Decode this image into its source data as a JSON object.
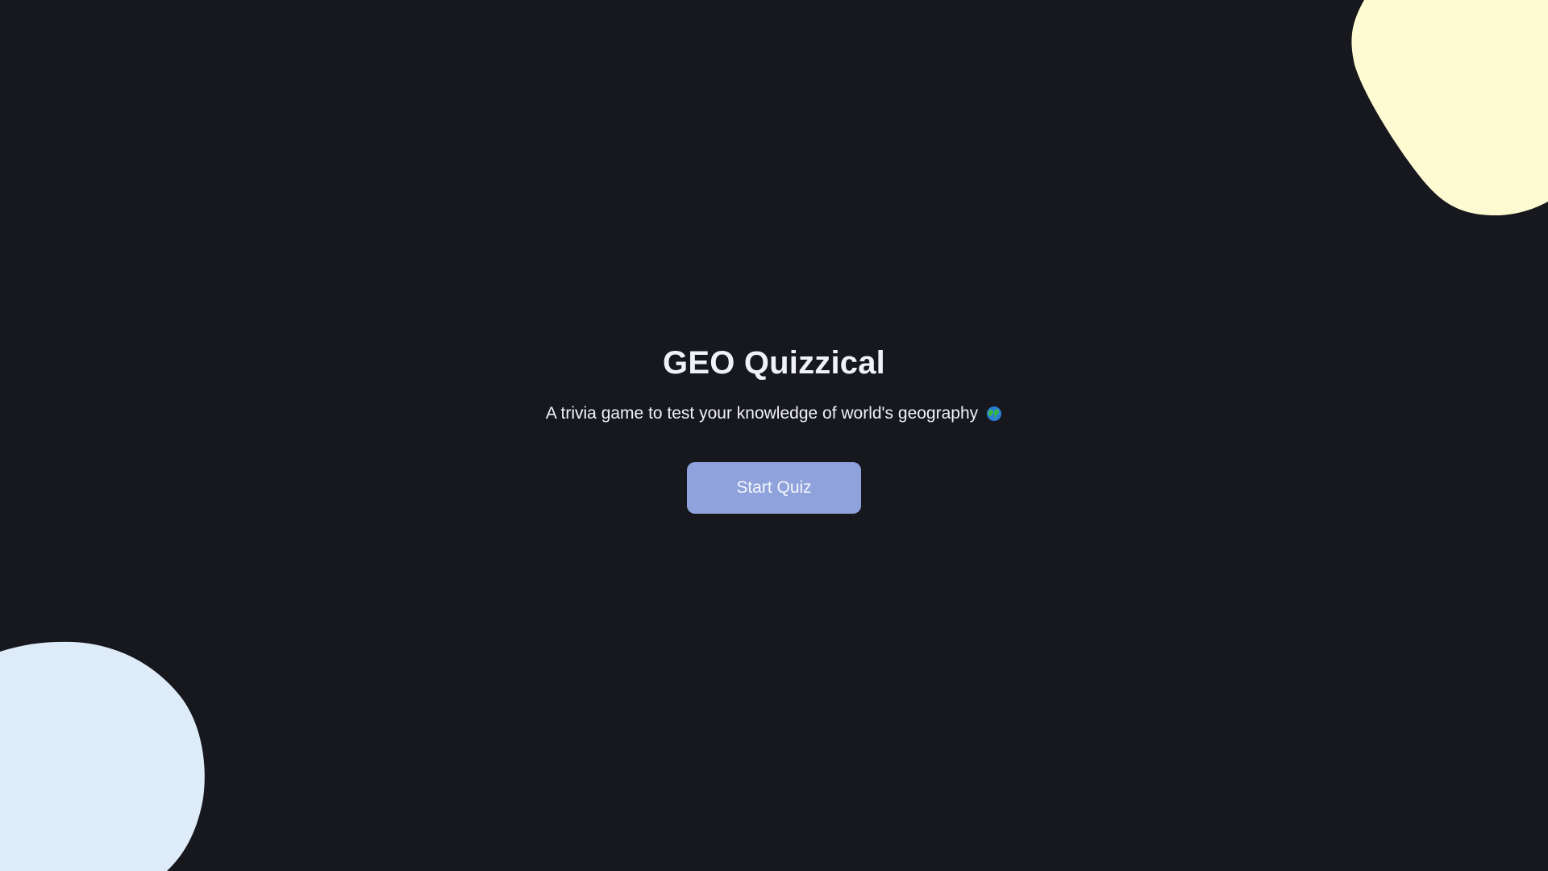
{
  "app": {
    "title": "GEO Quizzical",
    "subtitle": "A trivia game to test your knowledge of world's geography",
    "subtitle_icon": "globe-icon",
    "start_button_label": "Start Quiz"
  },
  "colors": {
    "background": "#17181d",
    "text": "#f1f2f7",
    "button": "#8fa2dc",
    "top_right_blob": "#fefad1",
    "bottom_left_blob": "#deebf8"
  }
}
